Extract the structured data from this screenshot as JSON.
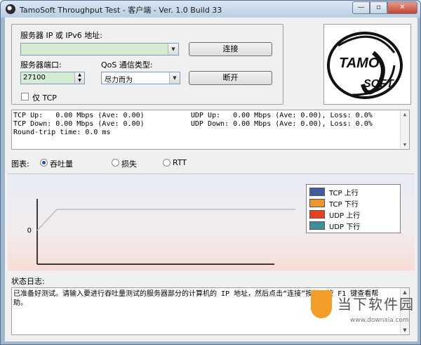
{
  "window": {
    "title": "TamoSoft Throughput Test - 客户端 - Ver. 1.0 Build 33",
    "min_glyph": "—",
    "max_glyph": "▫",
    "close_glyph": "✕"
  },
  "connection": {
    "server_label": "服务器 IP 或 IPv6 地址:",
    "server_value": "",
    "connect_label": "连接",
    "port_label": "服务器端口:",
    "port_value": "27100",
    "qos_label": "QoS 通信类型:",
    "qos_value": "尽力而为",
    "disconnect_label": "断开",
    "tcp_only_label": "仅 TCP",
    "tcp_only_checked": false
  },
  "logo": {
    "brand_text": "TAMOSOFT",
    "top": "TAMO",
    "bottom": "SOFT"
  },
  "stats": {
    "lines": [
      "TCP Up:   0.00 Mbps (Ave: 0.00)           UDP Up:   0.00 Mbps (Ave: 0.00), Loss: 0.0%",
      "TCP Down: 0.00 Mbps (Ave: 0.00)           UDP Down: 0.00 Mbps (Ave: 0.00), Loss: 0.0%",
      "Round-trip time: 0.0 ms"
    ]
  },
  "chart_selector": {
    "label": "图表:",
    "options": [
      "吞吐量",
      "损失",
      "RTT"
    ],
    "selected": "吞吐量"
  },
  "chart_data": {
    "type": "line",
    "ytick": "0",
    "series": [
      {
        "name": "TCP 上行",
        "color": "#3e5f9c"
      },
      {
        "name": "TCP 下行",
        "color": "#f0962e"
      },
      {
        "name": "UDP 上行",
        "color": "#e8411c"
      },
      {
        "name": "UDP 下行",
        "color": "#3c8f96"
      }
    ]
  },
  "log": {
    "label": "状态日志:",
    "text": "已准备好测试。请输入要进行吞吐量测试的服务器部分的计算机的 IP 地址，然后点击“连接”按钮。按 F1 键查看帮助。"
  },
  "watermark": {
    "brand": "当下软件园",
    "url": "www.downxia.com"
  }
}
